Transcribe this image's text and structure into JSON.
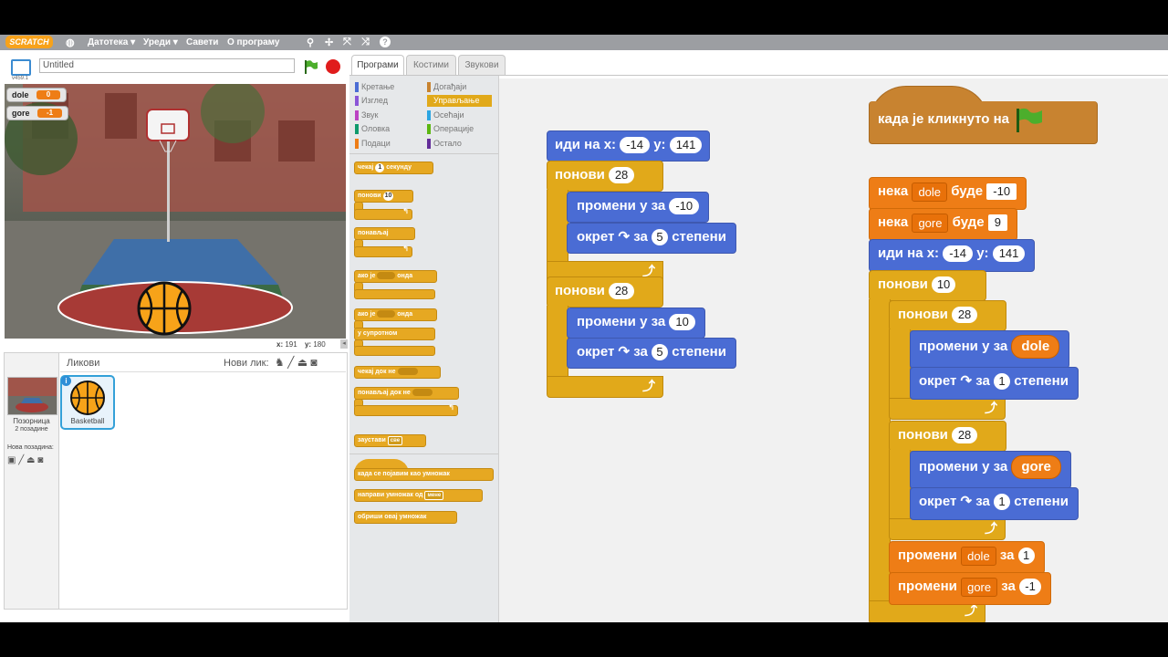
{
  "menu": {
    "logo": "SCRATCH",
    "items": [
      "Датотека ▾",
      "Уреди ▾",
      "Савети",
      "О програму"
    ]
  },
  "stage_header": {
    "version": "v459.1",
    "project_title": "Untitled"
  },
  "watchers": [
    {
      "name": "dole",
      "value": "0"
    },
    {
      "name": "gore",
      "value": "-1"
    }
  ],
  "stage_coords": {
    "x_label": "x:",
    "x": "191",
    "y_label": "y:",
    "y": "180"
  },
  "sprites": {
    "header": "Ликови",
    "new_sprite_label": "Нови лик:",
    "stage_label": "Позорница",
    "backdrop_count": "2 позадине",
    "new_backdrop_label": "Нова позадина:",
    "items": [
      {
        "name": "Basketball"
      }
    ]
  },
  "tabs": [
    "Програми",
    "Костими",
    "Звукови"
  ],
  "categories": {
    "left": [
      {
        "label": "Кретање",
        "color": "#4a6cd4"
      },
      {
        "label": "Изглед",
        "color": "#8a55d7"
      },
      {
        "label": "Звук",
        "color": "#bb42c3"
      },
      {
        "label": "Оловка",
        "color": "#0e9a6c"
      },
      {
        "label": "Подаци",
        "color": "#ee7d16"
      }
    ],
    "right": [
      {
        "label": "Догађаји",
        "color": "#c88330"
      },
      {
        "label": "Управљање",
        "color": "#e1a91a",
        "selected": true
      },
      {
        "label": "Осећаји",
        "color": "#2ca5e2"
      },
      {
        "label": "Операције",
        "color": "#5cb712"
      },
      {
        "label": "Остало",
        "color": "#632d99"
      }
    ]
  },
  "palette_blocks": {
    "wait": {
      "pre": "чекај",
      "val": "1",
      "post": "секунду"
    },
    "repeat": {
      "label": "понови",
      "val": "10"
    },
    "forever": "понављај",
    "if_then": {
      "pre": "ако је",
      "post": "онда"
    },
    "if_else": {
      "pre": "ако је",
      "post": "онда",
      "else": "у супротном"
    },
    "wait_until": "чекај док не",
    "repeat_until": "понављај док не",
    "stop": {
      "label": "заустави",
      "val": "све"
    },
    "clone_hat": "када се појавим као умножак",
    "create_clone": {
      "label": "направи умножак од",
      "val": "мене"
    },
    "delete_clone": "обриши овај умножак"
  },
  "scripts": {
    "s1": {
      "goto": {
        "label": "иди на x:",
        "x": "-14",
        "ylabel": "y:",
        "y": "141"
      },
      "repeat1": {
        "label": "понови",
        "n": "28"
      },
      "changey1": {
        "label": "промени y за",
        "val": "-10"
      },
      "turn1": {
        "label": "окрет",
        "za": "за",
        "val": "5",
        "unit": "степени"
      },
      "repeat2": {
        "label": "понови",
        "n": "28"
      },
      "changey2": {
        "label": "промени y за",
        "val": "10"
      },
      "turn2": {
        "label": "окрет",
        "za": "за",
        "val": "5",
        "unit": "степени"
      }
    },
    "s2": {
      "hat": "када је кликнуто на",
      "set1": {
        "label": "нека",
        "var": "dole",
        "mid": "буде",
        "val": "-10"
      },
      "set2": {
        "label": "нека",
        "var": "gore",
        "mid": "буде",
        "val": "9"
      },
      "goto": {
        "label": "иди на x:",
        "x": "-14",
        "ylabel": "y:",
        "y": "141"
      },
      "outer_repeat": {
        "label": "понови",
        "n": "10"
      },
      "repeatA": {
        "label": "понови",
        "n": "28"
      },
      "changeyA": {
        "label": "промени y за",
        "var": "dole"
      },
      "turnA": {
        "label": "окрет",
        "za": "за",
        "val": "1",
        "unit": "степени"
      },
      "repeatB": {
        "label": "понови",
        "n": "28"
      },
      "changeyB": {
        "label": "промени y за",
        "var": "gore"
      },
      "turnB": {
        "label": "окрет",
        "za": "за",
        "val": "1",
        "unit": "степени"
      },
      "change1": {
        "label": "промени",
        "var": "dole",
        "mid": "за",
        "val": "1"
      },
      "change2": {
        "label": "промени",
        "var": "gore",
        "mid": "за",
        "val": "-1"
      }
    }
  },
  "colors": {
    "motion": "#4a6cd4",
    "control": "#e1a91a",
    "events": "#c88330",
    "data": "#ee7d16"
  }
}
